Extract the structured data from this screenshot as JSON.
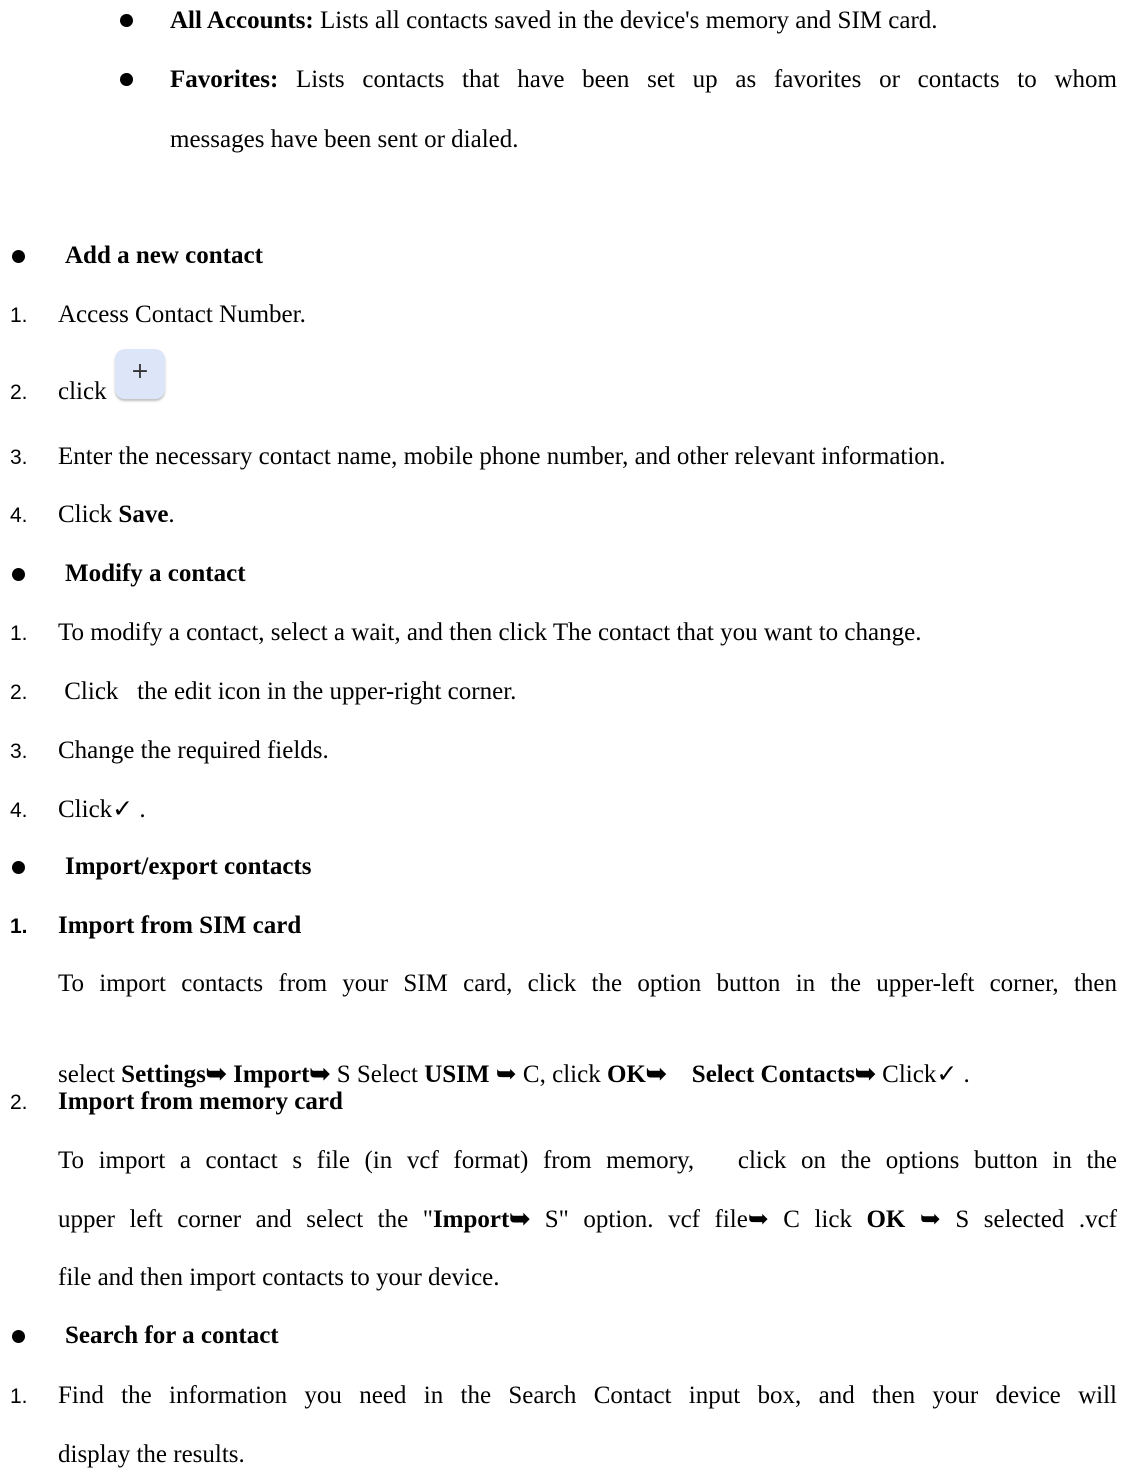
{
  "intro": {
    "all_accounts_title": "All Accounts:",
    "all_accounts_text": " Lists all contacts saved in the device's memory and SIM card.",
    "favorites_title": "Favorites:",
    "favorites_line1": " Lists contacts that have been set up as favorites or contacts to whom",
    "favorites_line2": "messages have been sent or dialed."
  },
  "add": {
    "heading": "Add a new contact",
    "s1_num": "1.",
    "s1_text": "Access Contact Number.",
    "s2_num": "2.",
    "s2_text": "click",
    "plus_symbol": "+",
    "s3_num": "3.",
    "s3_text": "Enter the necessary contact name, mobile phone number, and other relevant information.",
    "s4_num": "4.",
    "s4_a": "Click ",
    "s4_b": "Save",
    "s4_c": "."
  },
  "modify": {
    "heading": "Modify a contact",
    "s1_num": "1.",
    "s1_text": "To modify a contact, select a wait, and then click The contact that you want to change.",
    "s2_num": "2.",
    "s2_text": " Click   the edit icon in the upper-right corner.",
    "s3_num": "3.",
    "s3_text": "Change the required fields.",
    "s4_num": "4.",
    "s4_text": "Click✓ ."
  },
  "import_export": {
    "heading": "Import/export contacts",
    "sim": {
      "num": "1.",
      "title": "Import from SIM card",
      "line1": "To import contacts from your SIM card, click the option button in the upper-left corner, then",
      "l2_a": "select ",
      "l2_b": "Settings➥ Import➥",
      "l2_c": " S Select ",
      "l2_d": "USIM",
      "l2_e": " ➥ C, click ",
      "l2_f": "OK➥",
      "l2_g": "    ",
      "l2_h": "Select Contacts➥",
      "l2_i": " Click✓ ."
    },
    "memory": {
      "num": "2.",
      "title": "Import from memory card",
      "line1": "To import a contact s file (in vcf format) from memory,   click on the options button in the",
      "l2_a": "upper left corner and select the \"",
      "l2_b": "Import➥",
      "l2_c": " S\" option. vcf file➥ C lick ",
      "l2_d": "OK",
      "l2_e": " ➥ S selected .vcf",
      "line3": "file and then import contacts to your device."
    }
  },
  "search": {
    "heading": "Search for a contact",
    "s1_num": "1.",
    "line1": "Find the information you need in the Search Contact input box, and then your device will",
    "line2": "display the results."
  }
}
